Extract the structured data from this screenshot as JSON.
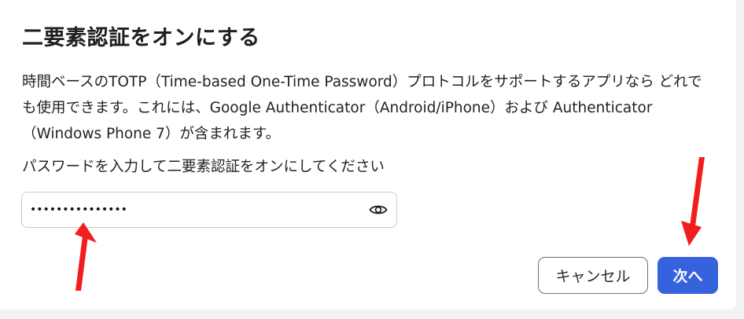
{
  "dialog": {
    "title": "二要素認証をオンにする",
    "description": "時間ベースのTOTP（Time-based One-Time Password）プロトコルをサポートするアプリなら どれでも使用できます。これには、Google Authenticator（Android/iPhone）および Authenticator（Windows Phone 7）が含まれます。",
    "password_label": "パスワードを入力して二要素認証をオンにしてください",
    "password_value": "•••••••••••••••",
    "eye_icon": "eye-icon",
    "cancel_label": "キャンセル",
    "next_label": "次へ"
  },
  "colors": {
    "primary": "#3662dd",
    "annotation_arrow": "#f21d1d",
    "background": "#f3f3f3"
  }
}
